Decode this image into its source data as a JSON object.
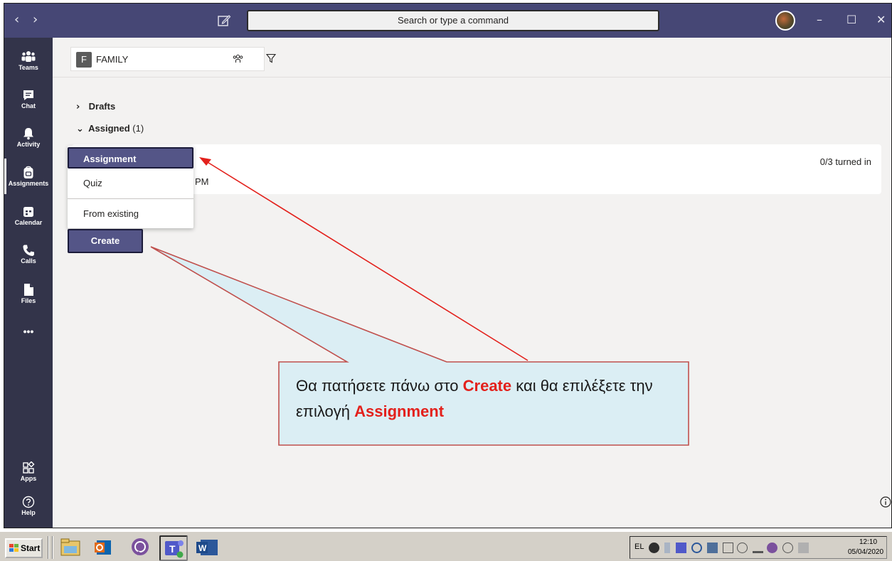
{
  "window": {
    "search_placeholder": "Search or type a command",
    "nav_back": "‹",
    "nav_forward": "›",
    "minimize": "–",
    "maximize": "☐",
    "close": "✕"
  },
  "rail": {
    "items": [
      {
        "label": "Teams",
        "icon": "teams-icon"
      },
      {
        "label": "Chat",
        "icon": "chat-icon"
      },
      {
        "label": "Activity",
        "icon": "bell-icon"
      },
      {
        "label": "Assignments",
        "icon": "backpack-icon",
        "active": true
      },
      {
        "label": "Calendar",
        "icon": "calendar-icon"
      },
      {
        "label": "Calls",
        "icon": "phone-icon"
      },
      {
        "label": "Files",
        "icon": "file-icon"
      }
    ],
    "more": "•••",
    "apps_label": "Apps",
    "help_label": "Help"
  },
  "team": {
    "initial": "F",
    "name": "FAMILY"
  },
  "sections": {
    "drafts": "Drafts",
    "assigned": "Assigned",
    "assigned_count": "(1)"
  },
  "card": {
    "due_fragment": "PM",
    "status": "0/3 turned in"
  },
  "create_menu": {
    "assignment": "Assignment",
    "quiz": "Quiz",
    "from_existing": "From existing"
  },
  "create_button": "Create",
  "annotation": {
    "part1": "Θα πατήσετε πάνω στο ",
    "highlight1": "Create",
    "part2": " και θα επιλέξετε την επιλογή ",
    "highlight2": "Assignment"
  },
  "taskbar": {
    "start": "Start",
    "lang": "EL",
    "time": "12:10",
    "date": "05/04/2020"
  },
  "colors": {
    "titlebar": "#464775",
    "rail": "#33344a",
    "accent": "#545587",
    "annotation_red": "#e3211c",
    "callout_fill": "#dbeef4",
    "callout_border": "#c0504d"
  }
}
